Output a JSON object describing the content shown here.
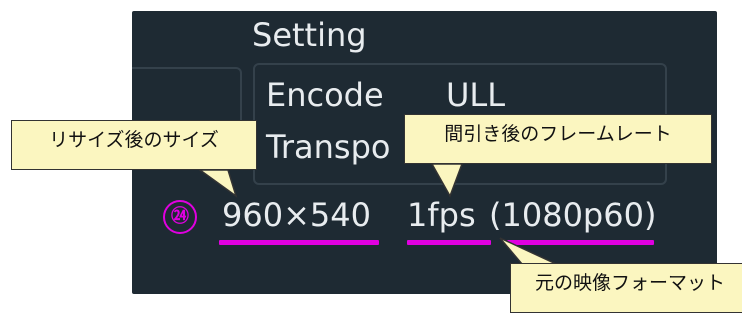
{
  "settings": {
    "title": "Setting",
    "encode_label": "Encode",
    "encode_value": "ULL",
    "transport_label": "Transpo"
  },
  "stream_info": {
    "resolution": "960×540",
    "fps": "1fps",
    "source_format": "(1080p60)"
  },
  "annotations": {
    "marker": "㉔",
    "resize_callout": "リサイズ後のサイズ",
    "thinned_rate_callout": "間引き後のフレームレート",
    "original_format_callout": "元の映像フォーマット"
  },
  "colors": {
    "panel": "#1e2a33",
    "highlight": "#e000e0",
    "callout": "#fbf6c0"
  }
}
